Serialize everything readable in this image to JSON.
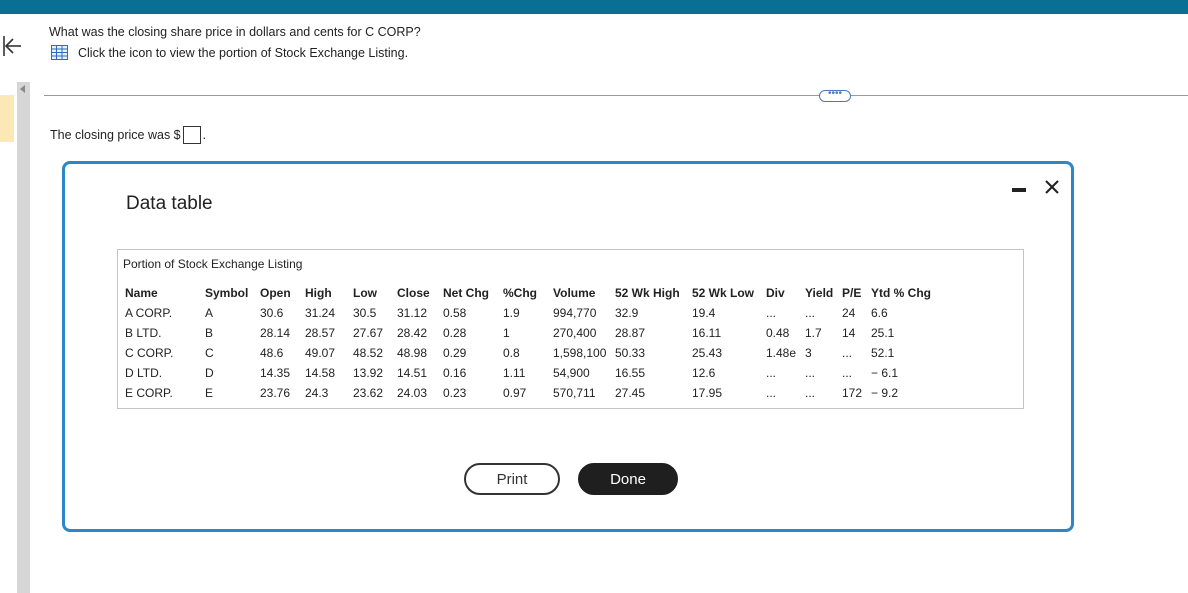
{
  "question": {
    "text": "What was the closing share price in dollars and cents for C CORP?",
    "icon_instruction": "Click the icon to view the portion of Stock Exchange Listing."
  },
  "answer": {
    "prefix": "The closing price was $",
    "suffix": "."
  },
  "more_button": "••••",
  "modal": {
    "title": "Data table",
    "listing_title": "Portion of Stock Exchange Listing",
    "columns": [
      "Name",
      "Symbol",
      "Open",
      "High",
      "Low",
      "Close",
      "Net Chg",
      "%Chg",
      "Volume",
      "52 Wk High",
      "52 Wk Low",
      "Div",
      "Yield",
      "P/E",
      "Ytd % Chg"
    ],
    "rows": [
      [
        "A CORP.",
        "A",
        "30.6",
        "31.24",
        "30.5",
        "31.12",
        "0.58",
        "1.9",
        "994,770",
        "32.9",
        "19.4",
        "...",
        "...",
        "24",
        "6.6"
      ],
      [
        "B LTD.",
        "B",
        "28.14",
        "28.57",
        "27.67",
        "28.42",
        "0.28",
        "1",
        "270,400",
        "28.87",
        "16.11",
        "0.48",
        "1.7",
        "14",
        "25.1"
      ],
      [
        "C CORP.",
        "C",
        "48.6",
        "49.07",
        "48.52",
        "48.98",
        "0.29",
        "0.8",
        "1,598,100",
        "50.33",
        "25.43",
        "1.48e",
        "3",
        "...",
        "52.1"
      ],
      [
        "D LTD.",
        "D",
        "14.35",
        "14.58",
        "13.92",
        "14.51",
        "0.16",
        "1.11",
        "54,900",
        "16.55",
        "12.6",
        "...",
        "...",
        "...",
        "− 6.1"
      ],
      [
        "E CORP.",
        "E",
        "23.76",
        "24.3",
        "23.62",
        "24.03",
        "0.23",
        "0.97",
        "570,711",
        "27.45",
        "17.95",
        "...",
        "...",
        "172",
        "− 9.2"
      ]
    ],
    "print_label": "Print",
    "done_label": "Done"
  },
  "colors": {
    "top_bar": "#0a6f95",
    "modal_border": "#2d86c8",
    "done_button": "#1f1f1f"
  },
  "icons": [
    "back-arrow-icon",
    "table-grid-icon",
    "minimize-icon",
    "close-icon"
  ]
}
